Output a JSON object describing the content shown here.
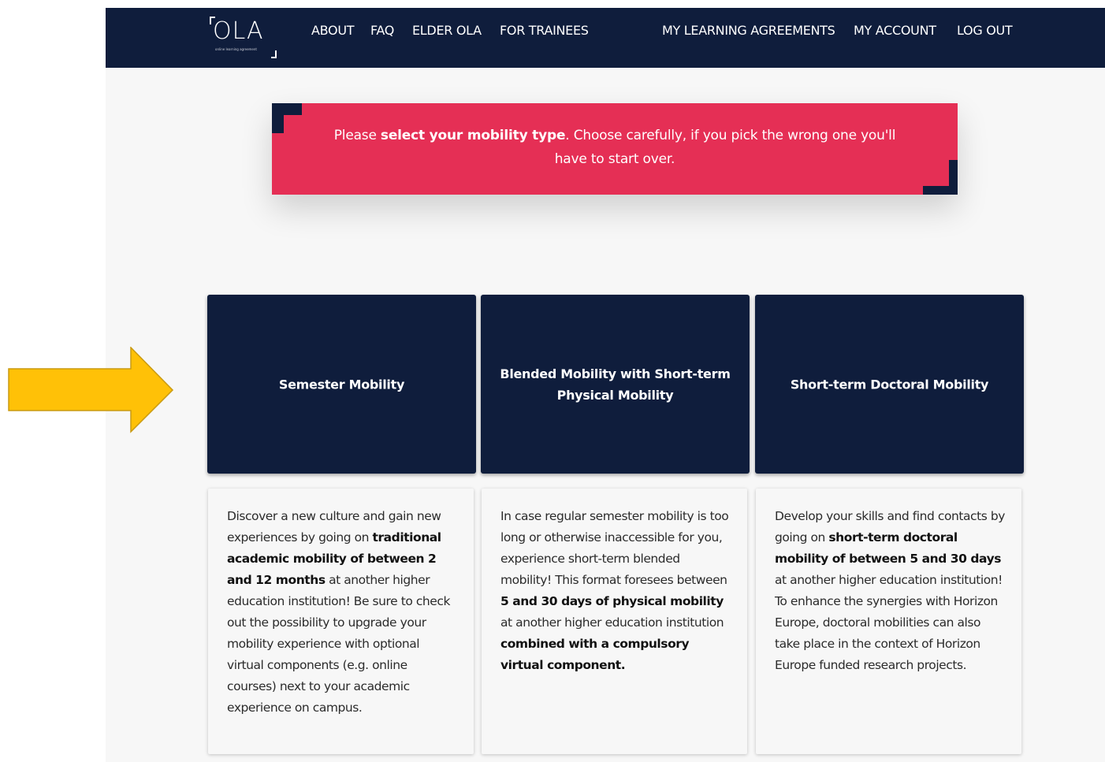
{
  "nav": {
    "logo_text": "OLA",
    "logo_sub": "online learning agreement",
    "links_left": [
      "ABOUT",
      "FAQ",
      "ELDER OLA",
      "FOR TRAINEES"
    ],
    "links_right": [
      "MY LEARNING AGREEMENTS",
      "MY ACCOUNT",
      "LOG OUT"
    ]
  },
  "banner": {
    "pre": "Please ",
    "bold": "select your mobility type",
    "post": ". Choose carefully, if you pick the wrong one you'll have to start over."
  },
  "cards": [
    {
      "title": "Semester Mobility",
      "desc": [
        {
          "t": "Discover a new culture and gain new experiences by going on ",
          "b": false
        },
        {
          "t": "traditional academic mobility of between 2 and 12 months",
          "b": true
        },
        {
          "t": " at another higher education institution! Be sure to check out the possibility to upgrade your mobility experience with optional virtual components (e.g. online courses) next to your academic experience on campus.",
          "b": false
        }
      ]
    },
    {
      "title": "Blended Mobility with Short-term Physical Mobility",
      "desc": [
        {
          "t": "In case regular semester mobility is too long or otherwise inaccessible for you, experience short-term blended mobility! This format foresees between ",
          "b": false
        },
        {
          "t": "5 and 30 days of physical mobility",
          "b": true
        },
        {
          "t": " at another higher education institution ",
          "b": false
        },
        {
          "t": "combined with a compulsory virtual component.",
          "b": true
        }
      ]
    },
    {
      "title": "Short-term Doctoral Mobility",
      "desc": [
        {
          "t": "Develop your skills and find contacts by going on ",
          "b": false
        },
        {
          "t": "short-term doctoral mobility of between 5 and 30 days",
          "b": true
        },
        {
          "t": " at another higher education institution! To enhance the synergies with Horizon Europe, doctoral mobilities can also take place in the context of Horizon Europe funded research projects.",
          "b": false
        }
      ]
    }
  ],
  "colors": {
    "navy": "#0f1d3c",
    "banner_red": "#e52f55",
    "arrow_fill": "#ffc107",
    "arrow_stroke": "#c99a12",
    "page_bg": "#f7f7f7"
  },
  "icons": {
    "annotation": "arrow-right-icon"
  }
}
